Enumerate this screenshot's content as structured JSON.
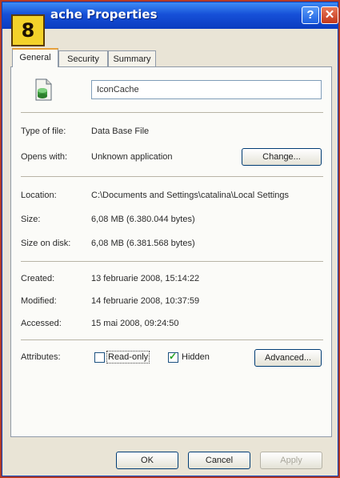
{
  "step_badge": "8",
  "window": {
    "title": "ache Properties",
    "help_glyph": "?",
    "close_glyph": "✕"
  },
  "tabs": [
    {
      "label": "General"
    },
    {
      "label": "Security"
    },
    {
      "label": "Summary"
    }
  ],
  "general": {
    "file_name": "IconCache",
    "type_label": "Type of file:",
    "type_value": "Data Base File",
    "opens_label": "Opens with:",
    "opens_value": "Unknown application",
    "change_button": "Change...",
    "location_label": "Location:",
    "location_value": "C:\\Documents and Settings\\catalina\\Local Settings",
    "size_label": "Size:",
    "size_value": "6,08 MB (6.380.044 bytes)",
    "size_on_disk_label": "Size on disk:",
    "size_on_disk_value": "6,08 MB (6.381.568 bytes)",
    "created_label": "Created:",
    "created_value": "13 februarie 2008, 15:14:22",
    "modified_label": "Modified:",
    "modified_value": "14 februarie 2008, 10:37:59",
    "accessed_label": "Accessed:",
    "accessed_value": "15 mai 2008, 09:24:50",
    "attributes_label": "Attributes:",
    "readonly_label": "Read-only",
    "readonly_checked": false,
    "hidden_label": "Hidden",
    "hidden_checked": true,
    "advanced_button": "Advanced..."
  },
  "footer": {
    "ok": "OK",
    "cancel": "Cancel",
    "apply": "Apply"
  }
}
